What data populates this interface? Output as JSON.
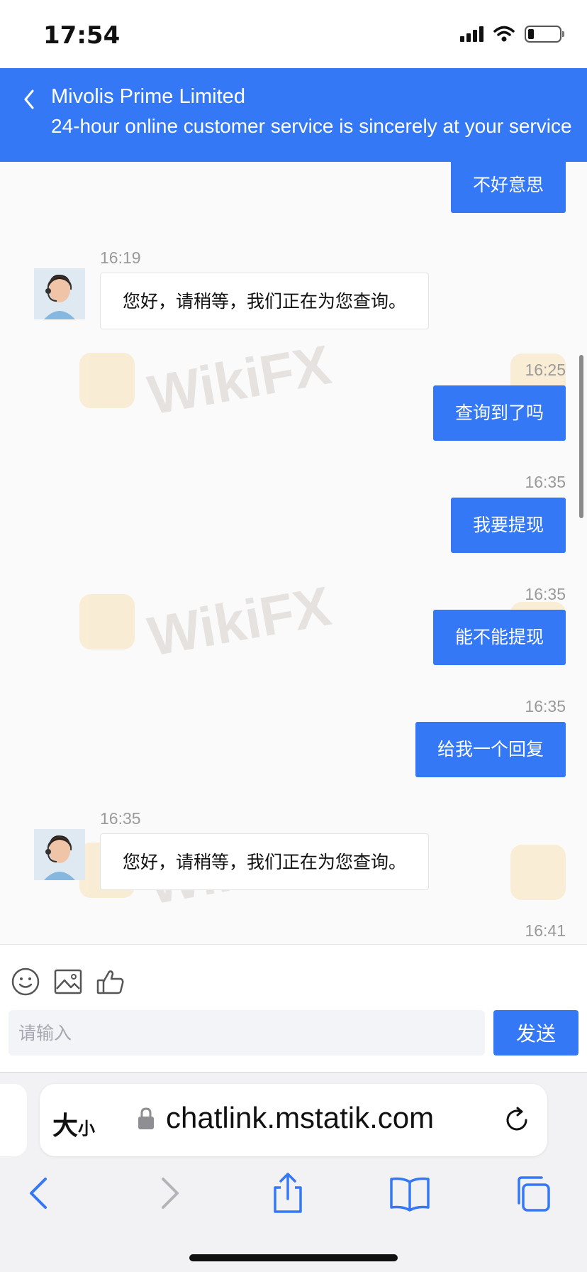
{
  "status_bar": {
    "time": "17:54"
  },
  "header": {
    "title": "Mivolis Prime Limited",
    "subtitle": "24-hour online customer service is sincerely at your service"
  },
  "watermark": {
    "text": "WikiFX"
  },
  "messages": [
    {
      "side": "out",
      "text": "不好意思"
    },
    {
      "side": "in",
      "time": "16:19",
      "text": "您好，请稍等，我们正在为您查询。"
    },
    {
      "side": "out",
      "time": "16:25",
      "text": "查询到了吗"
    },
    {
      "side": "out",
      "time": "16:35",
      "text": "我要提现"
    },
    {
      "side": "out",
      "time": "16:35",
      "text": "能不能提现"
    },
    {
      "side": "out",
      "time": "16:35",
      "text": "给我一个回复"
    },
    {
      "side": "in",
      "time": "16:35",
      "text": "您好，请稍等，我们正在为您查询。"
    },
    {
      "side": "out",
      "time": "16:41"
    }
  ],
  "composer": {
    "tools": [
      "smiley-icon",
      "image-icon",
      "thumbs-up-icon"
    ],
    "placeholder": "请输入",
    "send_label": "发送"
  },
  "browser": {
    "text_size_label": "大",
    "text_size_small": "小",
    "url": "chatlink.mstatik.com"
  },
  "colors": {
    "accent": "#3478f6",
    "background": "#fafafa"
  }
}
